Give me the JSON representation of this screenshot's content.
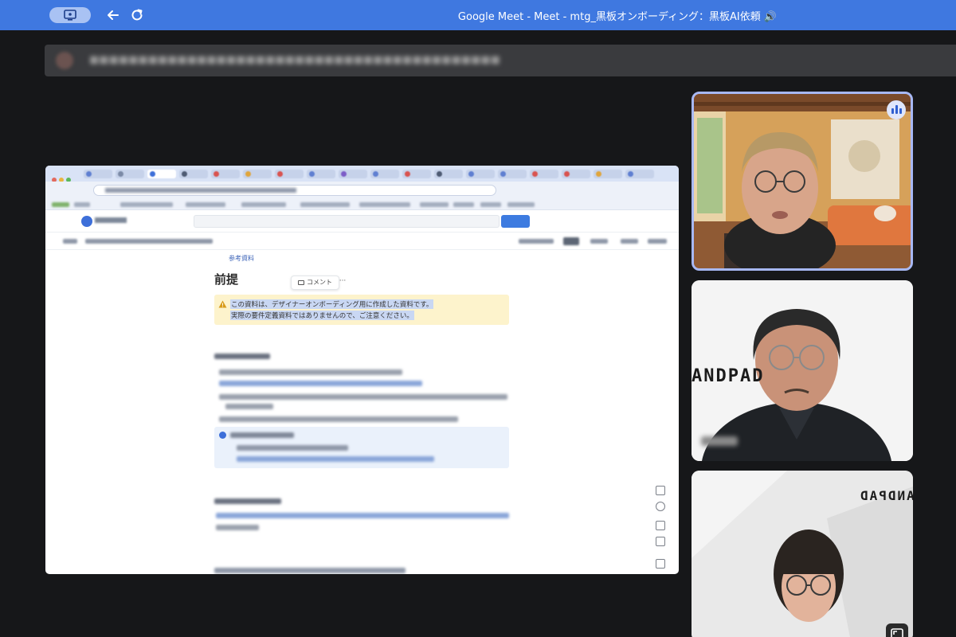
{
  "window": {
    "title": "Google Meet - Meet - mtg_黒板オンボーディング：黒板AI依頼 🔊"
  },
  "colors": {
    "top_bar": "#3f78e0",
    "background": "#161719",
    "speaking_border": "#a7b8f5",
    "callout": "#fdf3cc",
    "selection": "#c9d7f3"
  },
  "shared_doc": {
    "ref_link": "参考資料",
    "heading": "前提",
    "comment_label": "コメント",
    "more_label": "···",
    "callout_line1": "この資料は、デザイナーオンボーディング用に作成した資料です。",
    "callout_line2": "実際の要件定義資料ではありませんので、ご注意ください。"
  },
  "participants": [
    {
      "id": "participant-1",
      "speaking": true
    },
    {
      "id": "participant-2",
      "brand_text": "ANDPAD"
    },
    {
      "id": "participant-3",
      "brand_text": "ANDPAD"
    }
  ],
  "icons": {
    "app": "meet-window-icon",
    "back": "back-arrow-icon",
    "reload": "reload-icon",
    "warning": "warning-icon",
    "speaking": "audio-level-icon",
    "expand": "expand-icon"
  }
}
